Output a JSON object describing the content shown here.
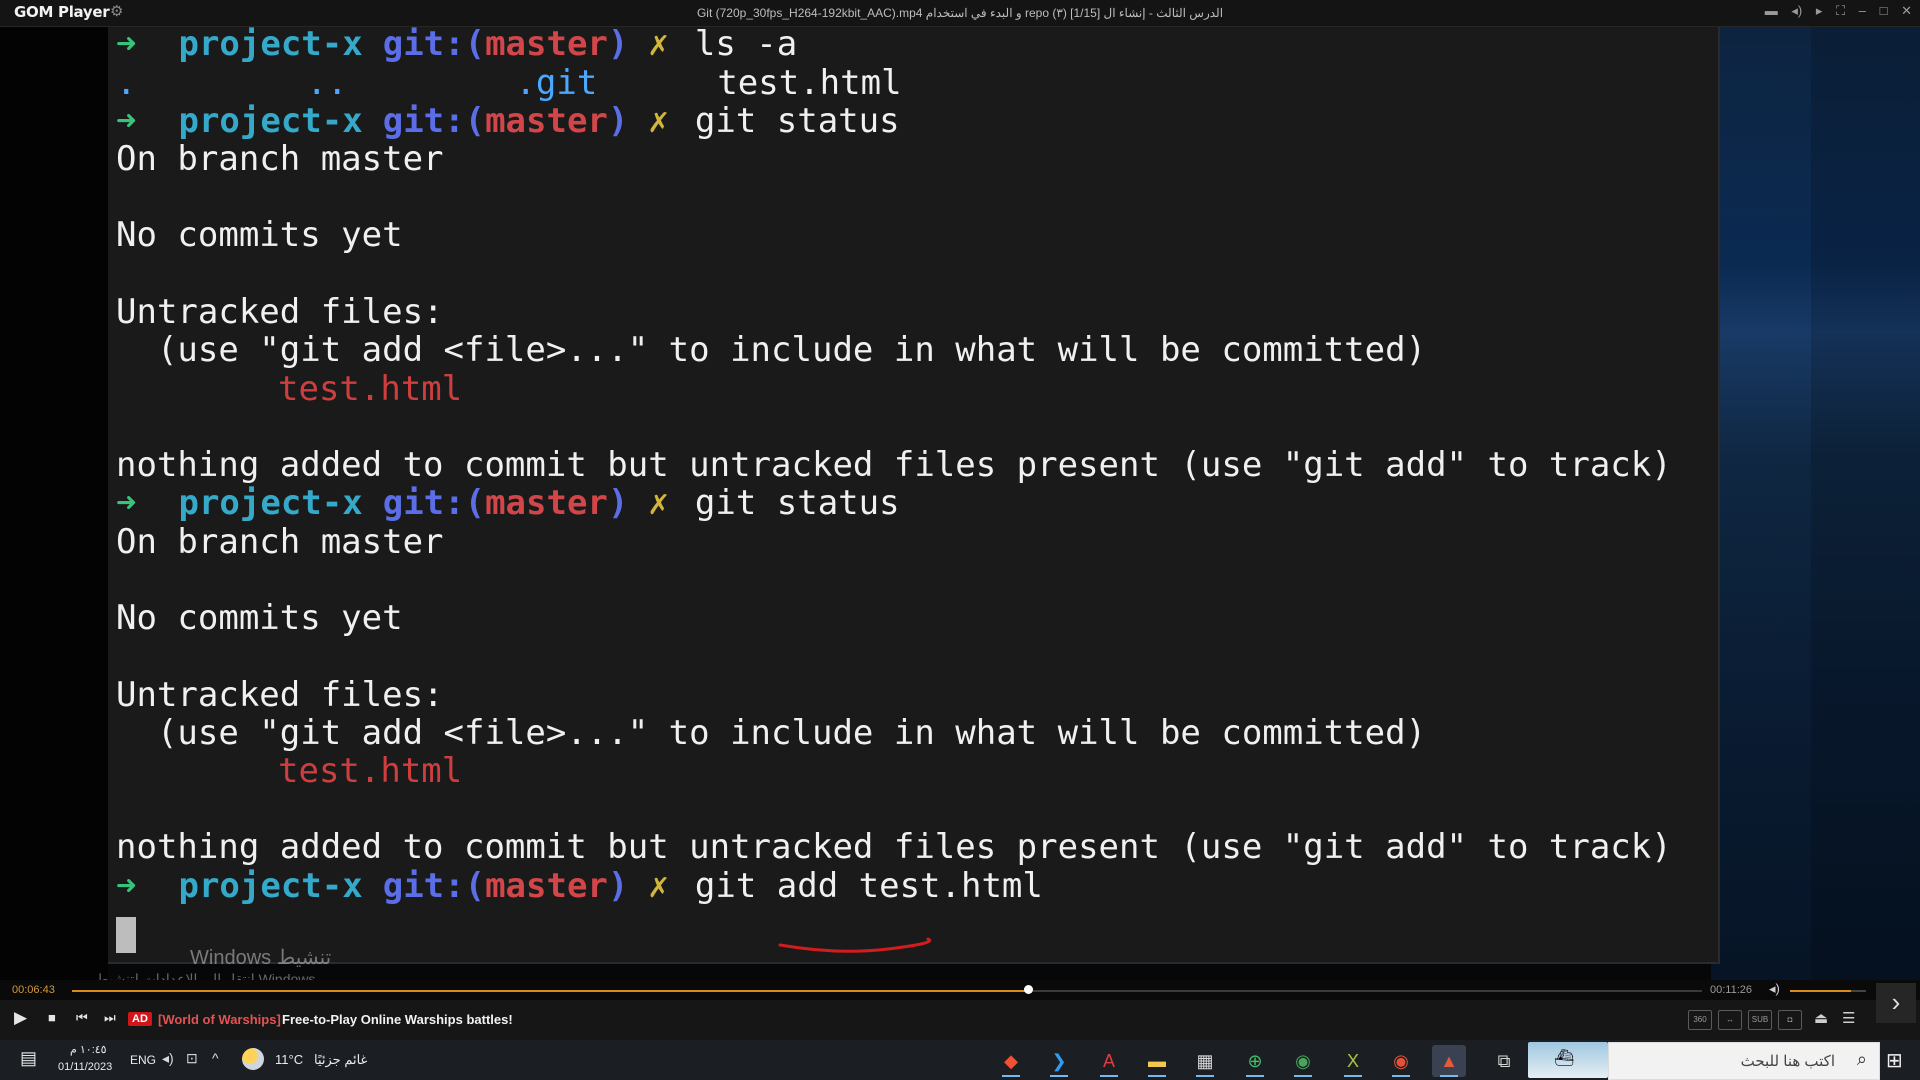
{
  "app": {
    "name": "GOM Player",
    "window_title": "Git (720p_30fps_H264-192kbit_AAC).mp4 و البدء في استخدام repo (٣) الدرس الثالث - إنشاء ال  [1/15]",
    "accent": "#d98d1a"
  },
  "terminal": {
    "lines": [
      {
        "type": "prompt",
        "arrow": "➜",
        "project": "project-x",
        "git": "git:(",
        "branch": "master",
        "git_close": ")",
        "x": "✗",
        "cmd": "ls -a"
      },
      {
        "type": "listing",
        "dot": ".",
        "dotdot": "..",
        "git_dir": ".git",
        "file": "test.html"
      },
      {
        "type": "prompt",
        "arrow": "➜",
        "project": "project-x",
        "git": "git:(",
        "branch": "master",
        "git_close": ")",
        "x": "✗",
        "cmd": "git status"
      },
      {
        "type": "out",
        "text": "On branch master"
      },
      {
        "type": "out",
        "text": "No commits yet"
      },
      {
        "type": "out",
        "text": "Untracked files:"
      },
      {
        "type": "out",
        "text": "  (use \"git add <file>...\" to include in what will be committed)"
      },
      {
        "type": "red",
        "text": "test.html"
      },
      {
        "type": "out",
        "text": "nothing added to commit but untracked files present (use \"git add\" to track)"
      },
      {
        "type": "prompt",
        "arrow": "➜",
        "project": "project-x",
        "git": "git:(",
        "branch": "master",
        "git_close": ")",
        "x": "✗",
        "cmd": "git status"
      },
      {
        "type": "out",
        "text": "On branch master"
      },
      {
        "type": "out",
        "text": "No commits yet"
      },
      {
        "type": "out",
        "text": "Untracked files:"
      },
      {
        "type": "out",
        "text": "  (use \"git add <file>...\" to include in what will be committed)"
      },
      {
        "type": "red",
        "text": "test.html"
      },
      {
        "type": "out",
        "text": "nothing added to commit but untracked files present (use \"git add\" to track)"
      },
      {
        "type": "prompt",
        "arrow": "➜",
        "project": "project-x",
        "git": "git:(",
        "branch": "master",
        "git_close": ")",
        "x": "✗",
        "cmd": "git add test.html"
      }
    ]
  },
  "overlay": {
    "activate_title": "Windows تنشيط",
    "activate_sub": "انتقل إلى الإعدادات لتنشيط Windows."
  },
  "player": {
    "time_current": "00:06:43",
    "time_total": "00:11:26",
    "progress": 0.587,
    "volume": 0.8,
    "ad_badge": "AD",
    "ad_brand": "[World of Warships]",
    "ad_text": "Free-to-Play Online Warships battles!",
    "tools": [
      "360",
      "↔",
      "SUB",
      "◘"
    ]
  },
  "taskbar": {
    "clock_time": "١٠:٤٥ م",
    "clock_date": "01/11/2023",
    "language": "ENG",
    "weather_temp": "11°C",
    "weather_desc": "غائم جزئيًا",
    "search_placeholder": "اكتب هنا للبحث",
    "apps": [
      {
        "name": "git-app-icon",
        "glyph": "◆",
        "color": "#f05133"
      },
      {
        "name": "vscode-app-icon",
        "glyph": "❯",
        "color": "#2f9cf0"
      },
      {
        "name": "acrobat-app-icon",
        "glyph": "A",
        "color": "#e63b3b"
      },
      {
        "name": "file-explorer-app-icon",
        "glyph": "▬",
        "color": "#f2c94c"
      },
      {
        "name": "media-app-icon",
        "glyph": "▦",
        "color": "#d8d8d8"
      },
      {
        "name": "globe-app-icon",
        "glyph": "⊕",
        "color": "#49b96a"
      },
      {
        "name": "chrome-app-icon",
        "glyph": "◉",
        "color": "#4aa35a"
      },
      {
        "name": "excel-app-icon",
        "glyph": "X",
        "color": "#a8c63d"
      },
      {
        "name": "chrome-profile-app-icon",
        "glyph": "◉",
        "color": "#e0533a"
      },
      {
        "name": "gom-player-app-icon",
        "glyph": "▲",
        "color": "#e45a3a"
      },
      {
        "name": "task-view-icon",
        "glyph": "⧉",
        "color": "#d8d8d8"
      }
    ]
  }
}
